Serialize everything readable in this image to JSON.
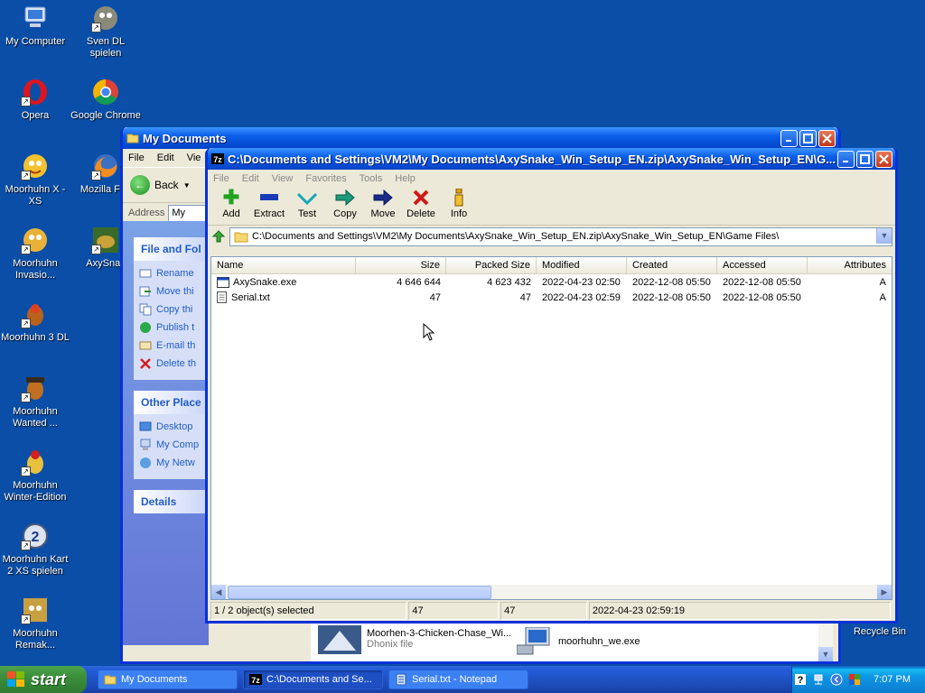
{
  "desktop": {
    "icons": [
      {
        "label": "My Computer"
      },
      {
        "label": "Sven DL spielen"
      },
      {
        "label": "Opera"
      },
      {
        "label": "Google Chrome"
      },
      {
        "label": "Moorhuhn X - XS"
      },
      {
        "label": "Mozilla Fire"
      },
      {
        "label": "Moorhuhn Invasio..."
      },
      {
        "label": "AxySnak"
      },
      {
        "label": "Moorhuhn 3 DL"
      },
      {
        "label": "Moorhuhn Wanted ..."
      },
      {
        "label": "Moorhuhn Winter-Edition"
      },
      {
        "label": "Moorhuhn Kart 2 XS spielen"
      },
      {
        "label": "Moorhuhn Remak..."
      },
      {
        "label": "Recycle Bin"
      }
    ]
  },
  "mydocs": {
    "title": "My Documents",
    "menu": [
      "File",
      "Edit",
      "Vie"
    ],
    "back_label": "Back",
    "address_label": "Address",
    "address_value": "My",
    "file_folder_tasks": {
      "header": "File and Fol",
      "items": [
        "Rename",
        "Move thi",
        "Copy thi",
        "Publish t",
        "E-mail th",
        "Delete th"
      ]
    },
    "other_places": {
      "header": "Other Place",
      "items": [
        "Desktop",
        "My Comp",
        "My Netw"
      ]
    },
    "details_header": "Details",
    "files": [
      {
        "name": "Moorhen-3-Chicken-Chase_Wi...",
        "sub": "Dhonix file"
      },
      {
        "name": "moorhuhn_we.exe"
      }
    ]
  },
  "zip": {
    "title": "C:\\Documents and Settings\\VM2\\My Documents\\AxySnake_Win_Setup_EN.zip\\AxySnake_Win_Setup_EN\\G...",
    "menu": [
      "File",
      "Edit",
      "View",
      "Favorites",
      "Tools",
      "Help"
    ],
    "toolbar": {
      "add": "Add",
      "extract": "Extract",
      "test": "Test",
      "copy": "Copy",
      "move": "Move",
      "delete": "Delete",
      "info": "Info"
    },
    "path": "C:\\Documents and Settings\\VM2\\My Documents\\AxySnake_Win_Setup_EN.zip\\AxySnake_Win_Setup_EN\\Game Files\\",
    "columns": [
      "Name",
      "Size",
      "Packed Size",
      "Modified",
      "Created",
      "Accessed",
      "Attributes"
    ],
    "rows": [
      {
        "name": "AxySnake.exe",
        "size": "4 646 644",
        "packed": "4 623 432",
        "modified": "2022-04-23 02:50",
        "created": "2022-12-08 05:50",
        "accessed": "2022-12-08 05:50",
        "attr": "A"
      },
      {
        "name": "Serial.txt",
        "size": "47",
        "packed": "47",
        "modified": "2022-04-23 02:59",
        "created": "2022-12-08 05:50",
        "accessed": "2022-12-08 05:50",
        "attr": "A"
      }
    ],
    "status": {
      "selection": "1 / 2 object(s) selected",
      "size": "47",
      "packed": "47",
      "modified": "2022-04-23 02:59:19"
    }
  },
  "taskbar": {
    "start": "start",
    "tasks": [
      {
        "label": "My Documents"
      },
      {
        "label": "C:\\Documents and Se..."
      },
      {
        "label": "Serial.txt - Notepad"
      }
    ],
    "clock": "7:07 PM"
  }
}
